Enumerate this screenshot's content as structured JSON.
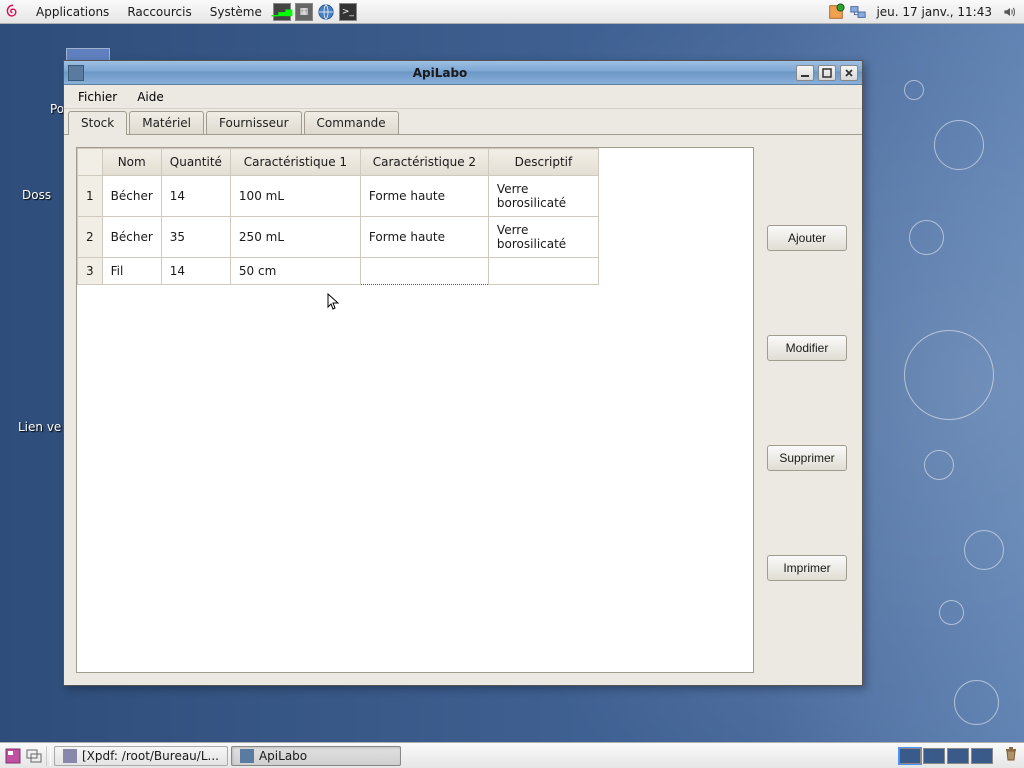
{
  "panel": {
    "menus": {
      "applications": "Applications",
      "raccourcis": "Raccourcis",
      "systeme": "Système"
    },
    "clock": "jeu. 17 janv., 11:43"
  },
  "desktop": {
    "label1": "Pos",
    "label2": "Doss",
    "label3": "Lien ve"
  },
  "window": {
    "title": "ApiLabo",
    "menubar": {
      "file": "Fichier",
      "help": "Aide"
    },
    "tabs": {
      "stock": "Stock",
      "materiel": "Matériel",
      "fournisseur": "Fournisseur",
      "commande": "Commande"
    },
    "table": {
      "headers": {
        "nom": "Nom",
        "quantite": "Quantité",
        "carac1": "Caractéristique 1",
        "carac2": "Caractéristique 2",
        "descriptif": "Descriptif"
      },
      "rows": [
        {
          "n": "1",
          "nom": "Bécher",
          "qte": "14",
          "c1": "100 mL",
          "c2": "Forme haute",
          "desc": "Verre borosilicaté"
        },
        {
          "n": "2",
          "nom": "Bécher",
          "qte": "35",
          "c1": "250 mL",
          "c2": "Forme haute",
          "desc": "Verre borosilicaté"
        },
        {
          "n": "3",
          "nom": "Fil",
          "qte": "14",
          "c1": "50 cm",
          "c2": "",
          "desc": ""
        }
      ]
    },
    "buttons": {
      "ajouter": "Ajouter",
      "modifier": "Modifier",
      "supprimer": "Supprimer",
      "imprimer": "Imprimer"
    }
  },
  "taskbar": {
    "task1": "[Xpdf: /root/Bureau/L...",
    "task2": "ApiLabo"
  }
}
